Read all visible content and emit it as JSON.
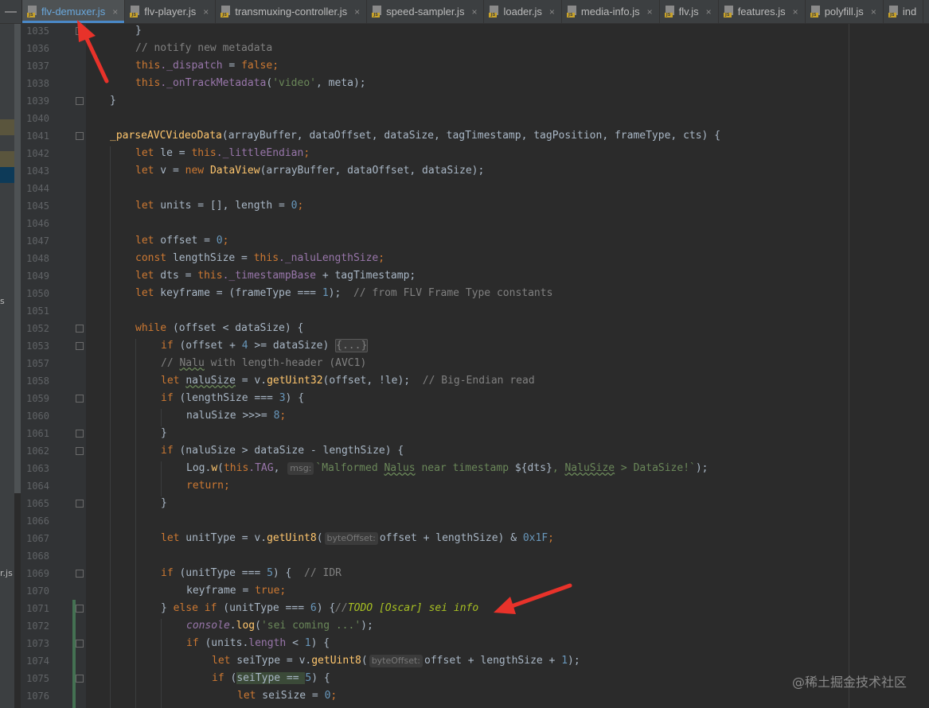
{
  "tabs": [
    {
      "label": "flv-demuxer.js",
      "active": true
    },
    {
      "label": "flv-player.js",
      "active": false
    },
    {
      "label": "transmuxing-controller.js",
      "active": false
    },
    {
      "label": "speed-sampler.js",
      "active": false
    },
    {
      "label": "loader.js",
      "active": false
    },
    {
      "label": "media-info.js",
      "active": false
    },
    {
      "label": "flv.js",
      "active": false
    },
    {
      "label": "features.js",
      "active": false
    },
    {
      "label": "polyfill.js",
      "active": false
    },
    {
      "label": "ind",
      "active": false
    }
  ],
  "tab_close_glyph": "×",
  "tab_collapse_glyph": "—",
  "left_strip_chars": [
    "s",
    "r.js"
  ],
  "line_numbers": [
    "1035",
    "1036",
    "1037",
    "1038",
    "1039",
    "1040",
    "1041",
    "1042",
    "1043",
    "1044",
    "1045",
    "1046",
    "1047",
    "1048",
    "1049",
    "1050",
    "1051",
    "1052",
    "1053",
    "1057",
    "1058",
    "1059",
    "1060",
    "1061",
    "1062",
    "1063",
    "1064",
    "1065",
    "1066",
    "1067",
    "1068",
    "1069",
    "1070",
    "1071",
    "1072",
    "1073",
    "1074",
    "1075",
    "1076"
  ],
  "code": {
    "l1035": {
      "t1": "}"
    },
    "l1036": {
      "c": "// notify new metadata"
    },
    "l1037": {
      "this": "this",
      "prop": "._dispatch",
      "eq": " = ",
      "val": "false",
      "semi": ";"
    },
    "l1038": {
      "this": "this",
      "prop": "._onTrackMetadata",
      "open": "(",
      "str": "'video'",
      "rest": ", meta);"
    },
    "l1039": {
      "t1": "}"
    },
    "l1041": {
      "fn": "_parseAVCVideoData",
      "params": "(arrayBuffer, dataOffset, dataSize, tagTimestamp, tagPosition, frameType, cts) {"
    },
    "l1042": {
      "kw": "let",
      "t1": " le = ",
      "this": "this",
      "prop": "._littleEndian",
      "semi": ";"
    },
    "l1043": {
      "kw": "let",
      "t1": " v = ",
      "kw2": "new",
      "sp": " ",
      "cls": "DataView",
      "rest": "(arrayBuffer, dataOffset, dataSize);"
    },
    "l1045": {
      "kw": "let",
      "t1": " units = [], length = ",
      "num": "0",
      "semi": ";"
    },
    "l1047": {
      "kw": "let",
      "t1": " offset = ",
      "num": "0",
      "semi": ";"
    },
    "l1048": {
      "kw": "const",
      "t1": " lengthSize = ",
      "this": "this",
      "prop": "._naluLengthSize",
      "semi": ";"
    },
    "l1049": {
      "kw": "let",
      "t1": " dts = ",
      "this": "this",
      "prop": "._timestampBase",
      "rest": " + tagTimestamp;"
    },
    "l1050": {
      "kw": "let",
      "t1": " keyframe = (frameType === ",
      "num": "1",
      "rest": ");",
      "c": "  // from FLV Frame Type constants"
    },
    "l1052": {
      "kw": "while",
      "rest": " (offset < dataSize) {"
    },
    "l1053": {
      "kw": "if",
      "t1": " (offset + ",
      "num": "4",
      "rest": " >= dataSize) ",
      "ph": "{...}"
    },
    "l1057": {
      "c1": "// ",
      "cw": "Nalu",
      "c2": " with length-header (AVC1)"
    },
    "l1058": {
      "kw": "let",
      "sp": " ",
      "var": "naluSize",
      "t1": " = v.",
      "fn": "getUint32",
      "rest": "(offset, !le);",
      "c": "  // Big-Endian read"
    },
    "l1059": {
      "kw": "if",
      "t1": " (lengthSize === ",
      "num": "3",
      "rest": ") {"
    },
    "l1060": {
      "t1": "naluSize >>>= ",
      "num": "8",
      "semi": ";"
    },
    "l1061": {
      "t1": "}"
    },
    "l1062": {
      "kw": "if",
      "rest": " (naluSize > dataSize - lengthSize) {"
    },
    "l1063": {
      "t1": "Log.",
      "fn": "w",
      "open": "(",
      "this": "this",
      "prop": ".TAG",
      "comma": ", ",
      "hint": "msg:",
      "s1": "`Malformed ",
      "sw1": "Nalus",
      "s2": " near timestamp ",
      "interp": "${dts}",
      "s3": ", ",
      "sw2": "NaluSize",
      "s4": " > DataSize!`",
      "close": ");"
    },
    "l1064": {
      "kw": "return",
      "semi": ";"
    },
    "l1065": {
      "t1": "}"
    },
    "l1067": {
      "kw": "let",
      "t1": " unitType = v.",
      "fn": "getUint8",
      "open": "(",
      "hint": "byteOffset:",
      "rest": "offset + lengthSize) & ",
      "num": "0x1F",
      "semi": ";"
    },
    "l1069": {
      "kw": "if",
      "t1": " (unitType === ",
      "num": "5",
      "rest": ") {",
      "c": "  // IDR"
    },
    "l1070": {
      "t1": "keyframe = ",
      "kw": "true",
      "semi": ";"
    },
    "l1071": {
      "t1": "} ",
      "kw": "else if",
      "t2": " (unitType === ",
      "num": "6",
      "rest": ") {",
      "c": "//",
      "todo": "TODO [Oscar] sei info"
    },
    "l1072": {
      "cons": "console",
      "t1": ".",
      "fn": "log",
      "open": "(",
      "str": "'sei coming ...'",
      "rest": ");"
    },
    "l1073": {
      "kw": "if",
      "t1": " (units.",
      "prop": "length",
      "t2": " < ",
      "num": "1",
      "rest": ") {"
    },
    "l1074": {
      "kw": "let",
      "t1": " seiType = v.",
      "fn": "getUint8",
      "open": "(",
      "hint": "byteOffset:",
      "rest": "offset + lengthSize + ",
      "num": "1",
      "semi": ");"
    },
    "l1075": {
      "kw": "if",
      "t1": " (",
      "hl": "seiType == ",
      "num": "5",
      "rest": ") {"
    },
    "l1076": {
      "kw": "let",
      "t1": " seiSize = ",
      "num": "0",
      "semi": ";"
    }
  },
  "watermark": "@稀土掘金技术社区",
  "colors": {
    "keyword": "#cc7832",
    "function": "#ffc66d",
    "field": "#9876aa",
    "number": "#6897bb",
    "string": "#6a8759",
    "comment": "#808080",
    "todo": "#a8c023",
    "annotation_arrow": "#e8322a"
  }
}
